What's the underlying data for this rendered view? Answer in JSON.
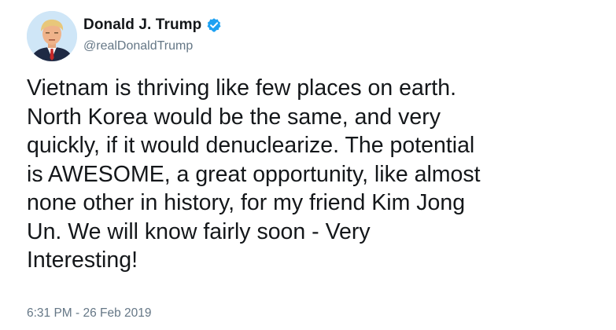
{
  "author": {
    "display_name": "Donald J. Trump",
    "handle": "@realDonaldTrump",
    "verified": true,
    "avatar_icon": "profile-photo"
  },
  "tweet": {
    "lines": [
      "Vietnam is thriving like few places on earth.",
      "North Korea would be the same, and very",
      "quickly, if it would denuclearize. The potential",
      "is AWESOME, a great opportunity, like almost",
      "none other in history, for my friend Kim Jong",
      "Un. We will know fairly soon - Very",
      "Interesting!"
    ],
    "timestamp": "6:31 PM - 26 Feb 2019"
  },
  "colors": {
    "text": "#14171a",
    "secondary_text": "#657786",
    "verified_blue": "#1da1f2",
    "background": "#ffffff"
  }
}
